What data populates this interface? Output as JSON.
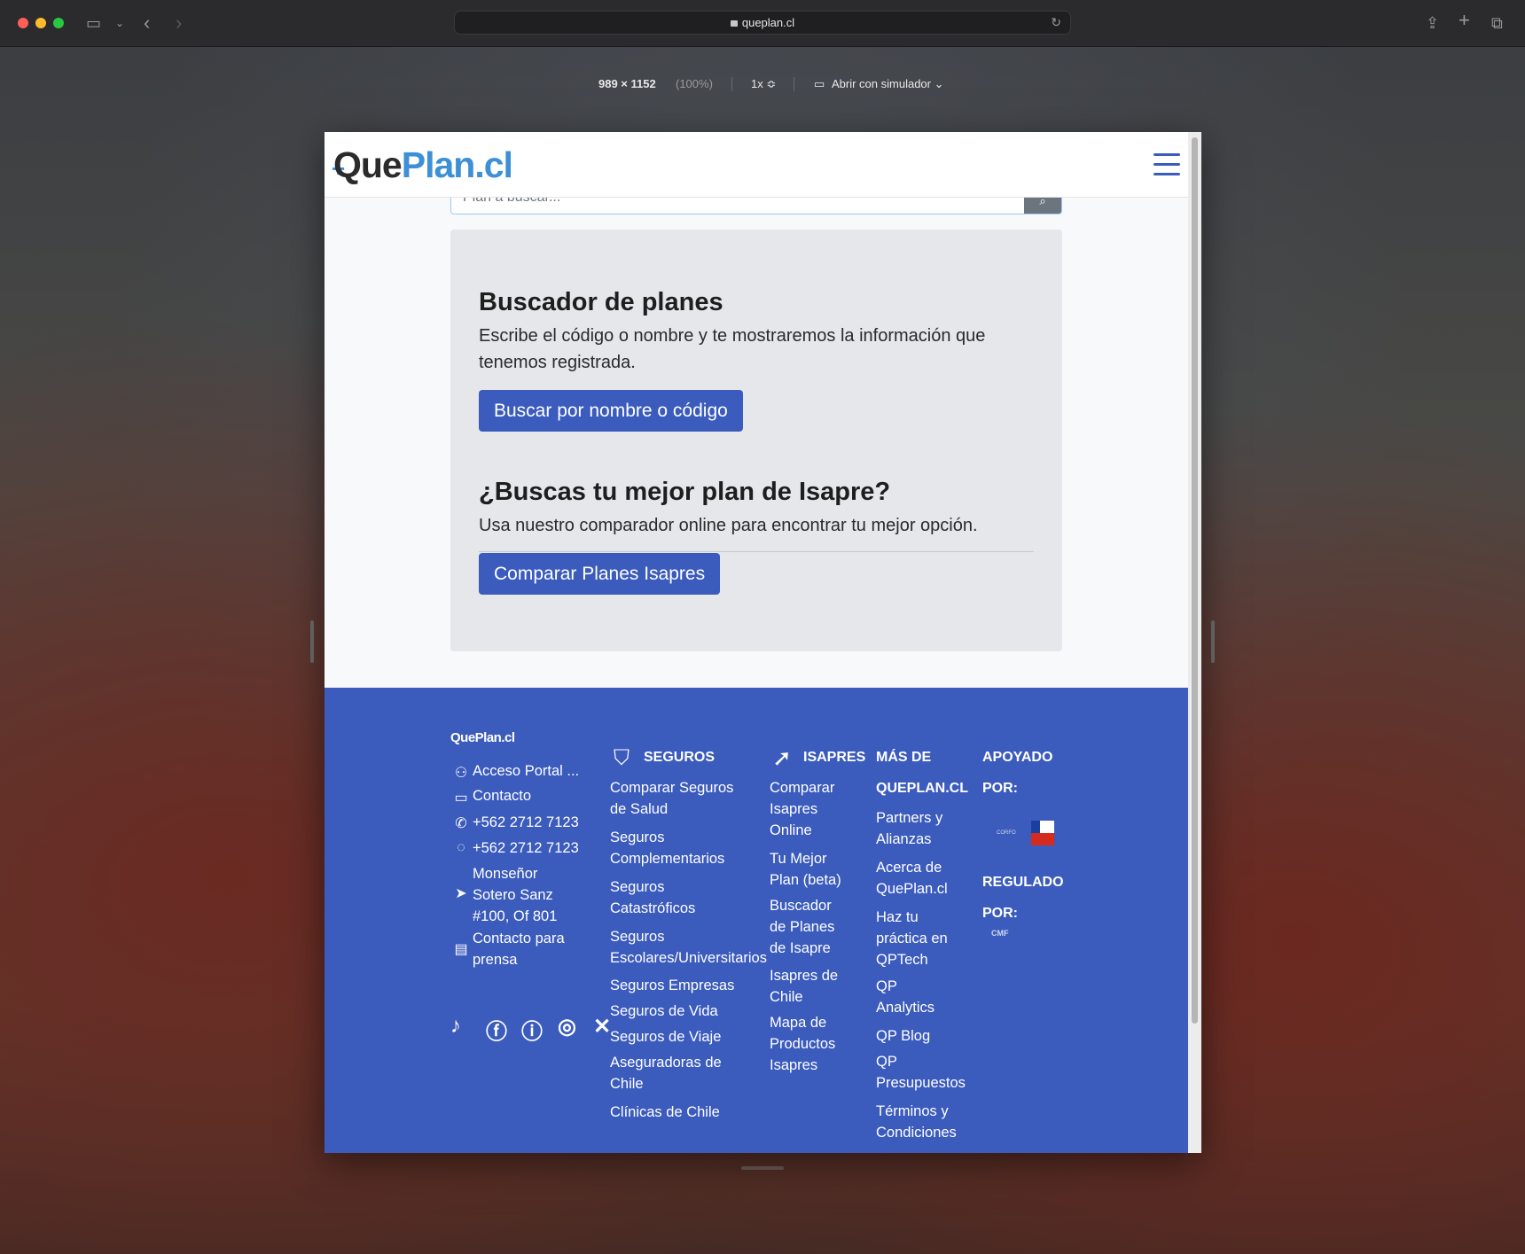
{
  "browser": {
    "url": "queplan.cl",
    "responsive": {
      "dimensions": "989 × 1152",
      "zoom": "(100%)",
      "scale": "1x ≎",
      "simulator": "Abrir con simulador ⌄"
    }
  },
  "navbar": {
    "logo_que": "Que",
    "logo_plan": "Plan.cl"
  },
  "search": {
    "placeholder": "Plan a buscar...",
    "button_icon": "search-icon"
  },
  "card": {
    "title1": "Buscador de planes",
    "text1": "Escribe el código o nombre y te mostraremos la información que tenemos registrada.",
    "button1": "Buscar por nombre o código",
    "title2": "¿Buscas tu mejor plan de Isapre?",
    "text2": "Usa nuestro comparador online para encontrar tu mejor opción.",
    "button2": "Comparar Planes Isapres",
    "accent_color": "#3b5bbd"
  },
  "footer": {
    "logo": "QuePlan.cl",
    "contact": {
      "portal": "Acceso Portal ...",
      "contacto": "Contacto",
      "phone": "+562 2712 7123",
      "whatsapp": "+562 2712 7123",
      "address": "Monseñor Sotero Sanz #100, Of 801",
      "prensa": "Contacto para prensa"
    },
    "seguros": {
      "heading": "SEGUROS",
      "items": [
        "Comparar Seguros de Salud",
        "Seguros Complementarios",
        "Seguros Catastróficos",
        "Seguros Escolares/Universitarios",
        "Seguros Empresas",
        "Seguros de Vida",
        "Seguros de Viaje",
        "Aseguradoras de Chile",
        "Clínicas de Chile"
      ]
    },
    "isapres": {
      "heading": "ISAPRES",
      "items": [
        "Comparar Isapres Online",
        "Tu Mejor Plan (beta)",
        "Buscador de Planes de Isapre",
        "Isapres de Chile",
        "Mapa de Productos Isapres"
      ]
    },
    "mas": {
      "heading": "MÁS DE QUEPLAN.CL",
      "items": [
        "Partners y Alianzas",
        "Acerca de QuePlan.cl",
        "Haz tu práctica en QPTech",
        "QP Analytics",
        "QP Blog",
        "QP Presupuestos",
        "Términos y Condiciones"
      ]
    },
    "apoyado": "APOYADO POR:",
    "regulado": "REGULADO POR:",
    "corfo": "CORFO",
    "cmf": "CMF",
    "social": [
      "tiktok-icon",
      "facebook-icon",
      "linkedin-icon",
      "instagram-icon",
      "x-icon"
    ],
    "bg_color": "#3b5bbd"
  }
}
